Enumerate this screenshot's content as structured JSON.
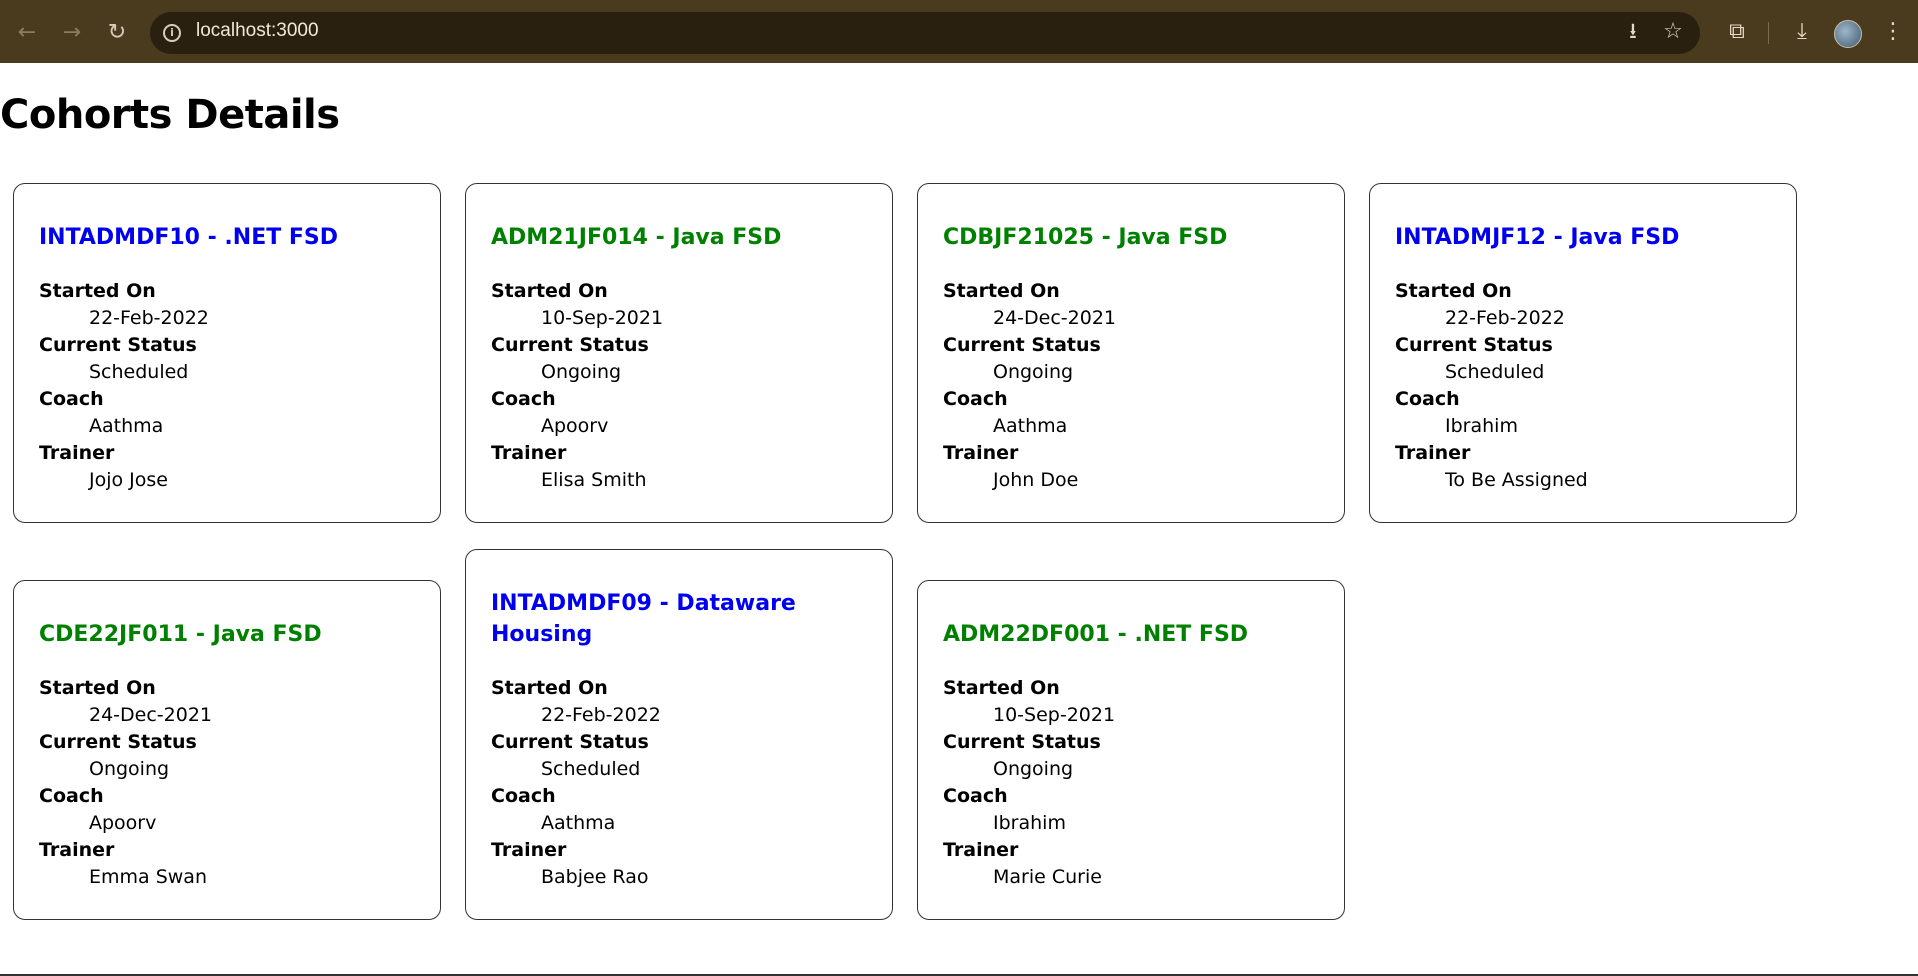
{
  "browser": {
    "url": "localhost:3000",
    "back_icon": "←",
    "forward_icon": "→",
    "reload_icon": "↻",
    "info_icon": "i",
    "install_icon": "⭳",
    "bookmark_icon": "☆",
    "extensions_icon": "⧉",
    "download_icon": "⤓",
    "menu_icon": "⋮"
  },
  "page": {
    "title": "Cohorts Details"
  },
  "labels": {
    "started_on": "Started On",
    "current_status": "Current Status",
    "coach": "Coach",
    "trainer": "Trainer"
  },
  "colors": {
    "scheduled": "#0000ee",
    "ongoing": "#008000"
  },
  "cohorts": [
    {
      "title": "INTADMDF10 - .NET FSD",
      "started_on": "22-Feb-2022",
      "status": "Scheduled",
      "coach": "Aathma",
      "trainer": "Jojo Jose"
    },
    {
      "title": "ADM21JF014 - Java FSD",
      "started_on": "10-Sep-2021",
      "status": "Ongoing",
      "coach": "Apoorv",
      "trainer": "Elisa Smith"
    },
    {
      "title": "CDBJF21025 - Java FSD",
      "started_on": "24-Dec-2021",
      "status": "Ongoing",
      "coach": "Aathma",
      "trainer": "John Doe"
    },
    {
      "title": "INTADMJF12 - Java FSD",
      "started_on": "22-Feb-2022",
      "status": "Scheduled",
      "coach": "Ibrahim",
      "trainer": "To Be Assigned"
    },
    {
      "title": "CDE22JF011 - Java FSD",
      "started_on": "24-Dec-2021",
      "status": "Ongoing",
      "coach": "Apoorv",
      "trainer": "Emma Swan"
    },
    {
      "title": "INTADMDF09 - Dataware Housing",
      "started_on": "22-Feb-2022",
      "status": "Scheduled",
      "coach": "Aathma",
      "trainer": "Babjee Rao"
    },
    {
      "title": "ADM22DF001 - .NET FSD",
      "started_on": "10-Sep-2021",
      "status": "Ongoing",
      "coach": "Ibrahim",
      "trainer": "Marie Curie"
    }
  ]
}
